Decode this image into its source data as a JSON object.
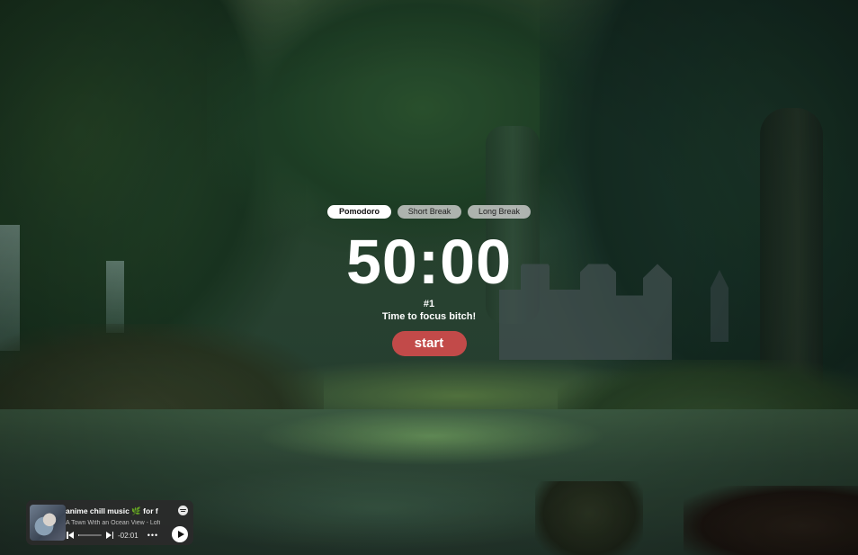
{
  "timer": {
    "tabs": [
      {
        "label": "Pomodoro",
        "active": true
      },
      {
        "label": "Short Break",
        "active": false
      },
      {
        "label": "Long Break",
        "active": false
      }
    ],
    "time": "50:00",
    "session": "#1",
    "message": "Time to focus bitch!",
    "start_label": "start",
    "start_color": "#c24a49"
  },
  "player": {
    "title": "anime chill music 🌿 for f",
    "subtitle": "A Town With an Ocean View - Lofi",
    "time_remaining": "-02:01",
    "progress": 0.05,
    "icons": {
      "brand": "music-service-logo-icon",
      "previous": "previous-track-icon",
      "next": "next-track-icon",
      "more": "more-options-icon",
      "play": "play-icon"
    }
  }
}
